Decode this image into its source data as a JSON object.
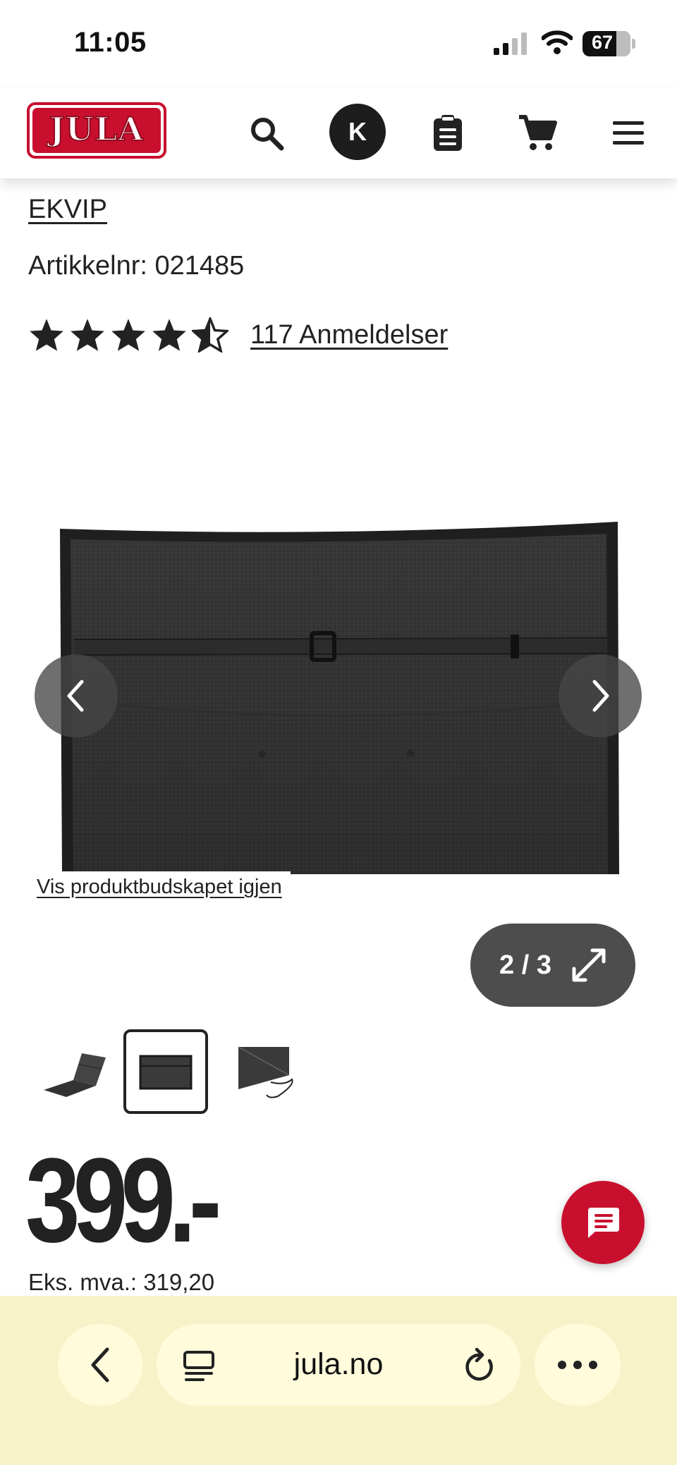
{
  "status_bar": {
    "time": "11:05",
    "battery": "67"
  },
  "header": {
    "logo": "JULA",
    "account_initial": "K",
    "icons": [
      "search-icon",
      "avatar",
      "clipboard-icon",
      "cart-icon",
      "menu-icon"
    ]
  },
  "product": {
    "brand": "EKVIP",
    "article_number": "Artikkelnr: 021485",
    "rating": {
      "stars": 4.5,
      "max": 5
    },
    "reviews_label": "117 Anmeldelser"
  },
  "gallery": {
    "show_message_link": "Vis produktbudskapet igjen",
    "counter": "2 / 3",
    "selected_index": 1,
    "thumbnails": [
      "lounger-cushion-thumb",
      "back-cushion-thumb",
      "cushion-corner-thumb"
    ]
  },
  "pricing": {
    "price": "399.-",
    "excl_vat": "Eks. mva.: 319,20"
  },
  "browser": {
    "url": "jula.no"
  },
  "colors": {
    "brand_red": "#c8102e",
    "browser_bar": "#f8f2c8",
    "dark": "#222222"
  }
}
